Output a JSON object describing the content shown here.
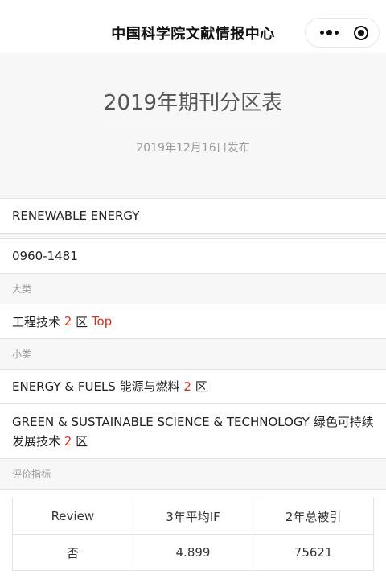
{
  "navbar": {
    "title": "中国科学院文献情报中心"
  },
  "header": {
    "title": "2019年期刊分区表",
    "date": "2019年12月16日发布"
  },
  "journal": {
    "name": "RENEWABLE ENERGY",
    "issn": "0960-1481"
  },
  "major_category": {
    "label": "大类",
    "name": "工程技术",
    "zone": "2",
    "zone_suffix": "区",
    "top": "Top"
  },
  "minor_category": {
    "label": "小类",
    "items": [
      {
        "name": "ENERGY & FUELS 能源与燃料",
        "zone": "2",
        "zone_suffix": "区"
      },
      {
        "name": "GREEN & SUSTAINABLE SCIENCE & TECHNOLOGY 绿色可持续发展技术",
        "zone": "2",
        "zone_suffix": "区"
      }
    ]
  },
  "metrics": {
    "label": "评价指标",
    "headers": [
      "Review",
      "3年平均IF",
      "2年总被引"
    ],
    "values": [
      "否",
      "4.899",
      "75621"
    ]
  }
}
